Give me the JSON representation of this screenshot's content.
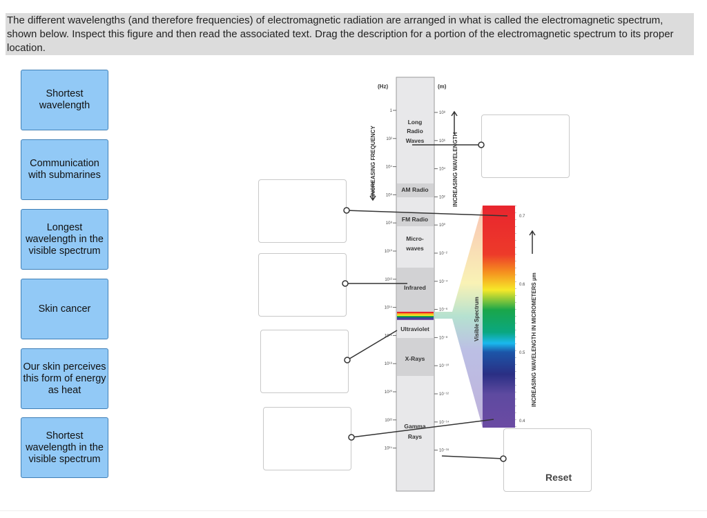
{
  "instructions": "The different wavelengths (and therefore frequencies) of electromagnetic radiation are arranged in what is called the electromagnetic spectrum, shown below. Inspect this figure and then read the associated text. Drag the description for a portion of the electromagnetic spectrum to its proper location.",
  "cards": [
    "Shortest wavelength",
    "Communication with submarines",
    "Longest wavelength in the visible spectrum",
    "Skin cancer",
    "Our skin perceives this form of energy as heat",
    "Shortest wavelength in the visible spectrum"
  ],
  "reset_label": "Reset",
  "figure": {
    "freq_unit": "(Hz)",
    "wave_unit": "(m)",
    "freq_axis_label": "INCREASING FREQUENCY",
    "wave_axis_label": "INCREASING WAVELENGTH",
    "freq_ticks": [
      "1",
      "10²",
      "10⁴",
      "10⁶",
      "10⁸",
      "10¹⁰",
      "10¹²",
      "10¹⁴",
      "10¹⁶",
      "10¹⁸",
      "10²⁰",
      "10²²",
      "10²⁴"
    ],
    "wave_ticks": [
      "10⁸",
      "10⁶",
      "10⁴",
      "10²",
      "10⁰",
      "10⁻²",
      "10⁻⁴",
      "10⁻⁶",
      "10⁻⁸",
      "10⁻¹⁰",
      "10⁻¹²",
      "10⁻¹⁴",
      "10⁻¹⁶"
    ],
    "bands": {
      "long1": "Long",
      "long2": "Radio",
      "long3": "Waves",
      "am": "AM Radio",
      "fm": "FM Radio",
      "micro1": "Micro-",
      "micro2": "waves",
      "ir": "Infrared",
      "uv": "Ultraviolet",
      "xray": "X-Rays",
      "gamma1": "Gamma",
      "gamma2": "Rays"
    },
    "visible_label": "Visible Spectrum",
    "visible_axis_label": "INCREASING WAVELENGTH IN MICROMETERS  µm",
    "visible_ticks": [
      "0.7",
      "0.6",
      "0.5",
      "0.4"
    ]
  }
}
